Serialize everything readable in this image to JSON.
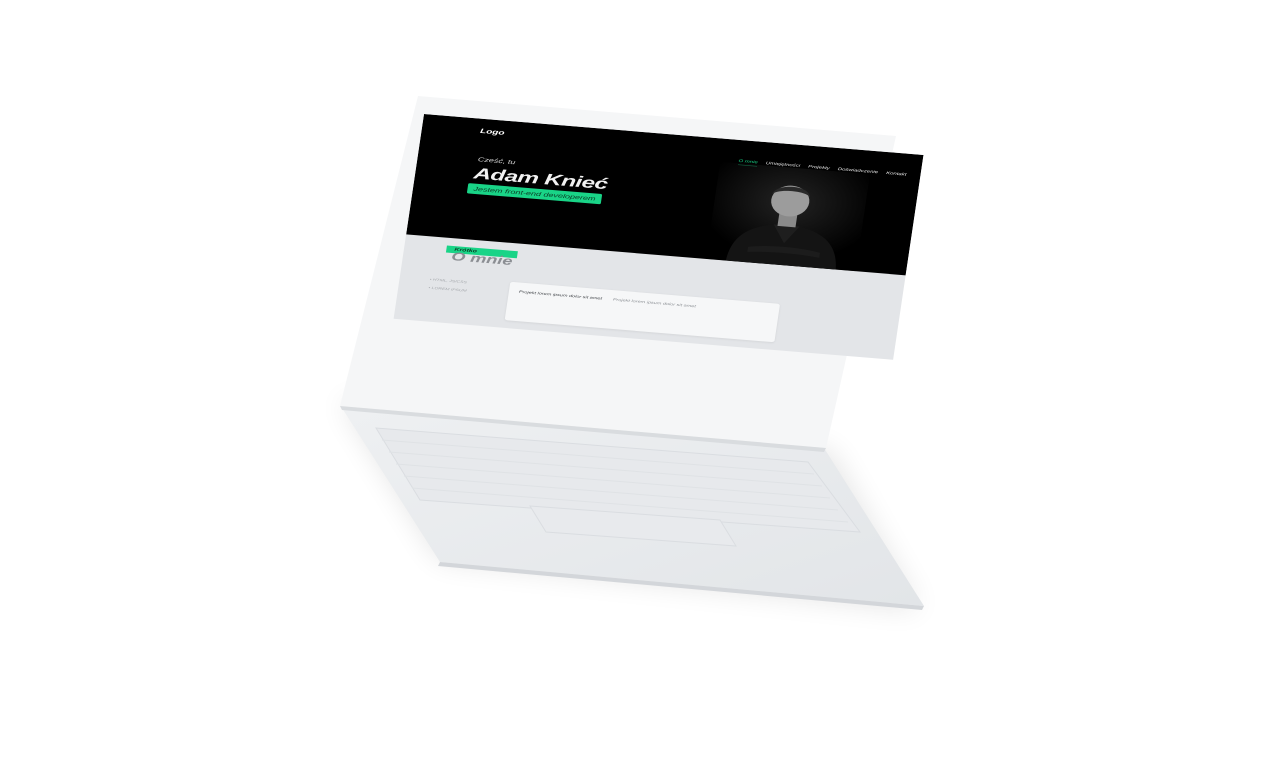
{
  "site": {
    "logo": "Logo",
    "nav": [
      "O mnie",
      "Umiejętności",
      "Projekty",
      "Doświadczenie",
      "Kontakt"
    ],
    "active_nav_index": 0,
    "hero": {
      "greeting": "Cześć, tu",
      "name": "Adam Knieć",
      "tagline": "Jestem front-end developerem"
    },
    "about": {
      "eyebrow": "Krótko",
      "heading": "O mnie",
      "skills": [
        "HTML, JS/CSS",
        "LOREM IPSUM"
      ],
      "card": {
        "title": "Projekt lorem ipsum dolor sit amet",
        "description": "Projekt lorem ipsum dolor sit amet"
      }
    }
  },
  "colors": {
    "accent": "#19d487",
    "hero_bg": "#000000",
    "device": "#e9ebee"
  },
  "icons": {
    "portrait": "person-photo"
  }
}
